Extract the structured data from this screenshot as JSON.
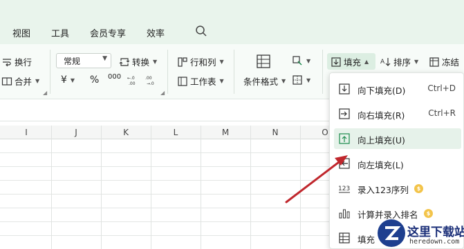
{
  "menu": {
    "items": [
      "视图",
      "工具",
      "会员专享",
      "效率"
    ]
  },
  "ribbon": {
    "wrap_label": "换行",
    "merge_label": "合并",
    "number_format": "常规",
    "convert_label": "转换",
    "rows_cols_label": "行和列",
    "worksheet_label": "工作表",
    "cond_format_label": "条件格式",
    "fill_label": "填充",
    "sort_label": "排序",
    "freeze_label": "冻结",
    "currency_symbol": "¥",
    "percent_symbol": "%",
    "thousands_symbol": "000"
  },
  "columns": [
    "I",
    "J",
    "K",
    "L",
    "M",
    "N",
    "O"
  ],
  "fill_menu": {
    "items": [
      {
        "label": "向下填充(D)",
        "shortcut": "Ctrl+D"
      },
      {
        "label": "向右填充(R)",
        "shortcut": "Ctrl+R"
      },
      {
        "label": "向上填充(U)",
        "shortcut": ""
      },
      {
        "label": "向左填充(L)",
        "shortcut": ""
      },
      {
        "label": "录入123序列",
        "shortcut": ""
      },
      {
        "label": "计算并录入排名",
        "shortcut": ""
      },
      {
        "label": "填充",
        "shortcut": ""
      }
    ]
  },
  "watermark": {
    "title": "这里下载站",
    "url": "heredown.com"
  },
  "colors": {
    "accent": "#1a8a4c",
    "arrow": "#c0272d",
    "menu_bg": "#e9f4ec",
    "hover": "#e6f2ea"
  }
}
